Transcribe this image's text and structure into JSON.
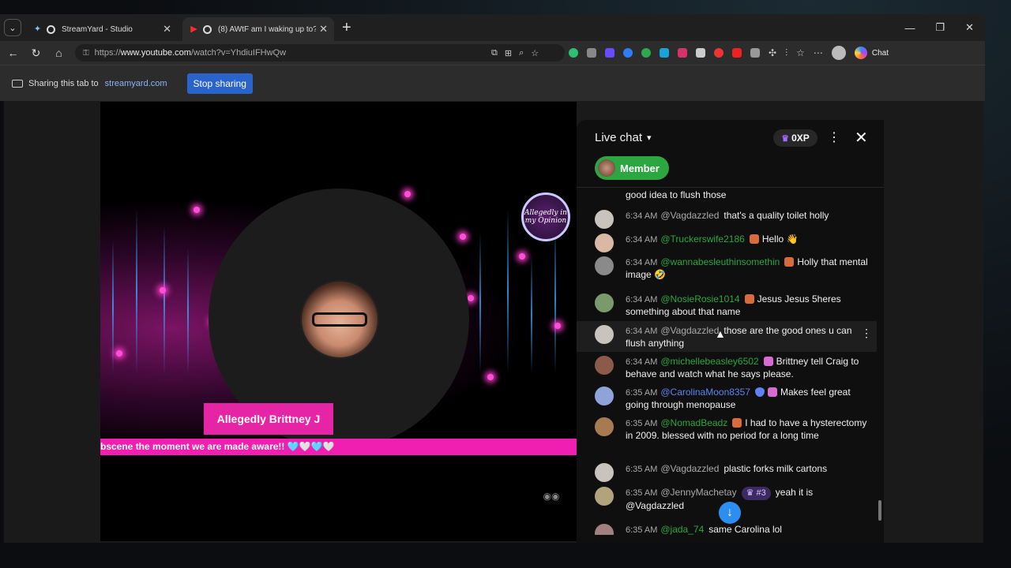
{
  "browser": {
    "tabs": [
      {
        "title": "StreamYard - Studio",
        "icon": "streamyard-icon"
      },
      {
        "title": "(8) AWtF am I waking up to?!",
        "icon": "youtube-icon"
      }
    ],
    "url_prefix": "https://",
    "url_host": "www.youtube.com",
    "url_path": "/watch?v=YhdiuIFHwQw",
    "copilot_label": "Chat"
  },
  "sharebar": {
    "text": "Sharing this tab to",
    "host": "streamyard.com",
    "stop_label": "Stop sharing"
  },
  "video": {
    "logo_text": "Allegedly in my Opinion",
    "name_plate": "Allegedly Brittney J",
    "ticker": "bscene the moment we are made aware!! 🩵🤍🩵🤍"
  },
  "chat": {
    "title": "Live chat",
    "xp": "0XP",
    "member_label": "Member",
    "messages": [
      {
        "time": "",
        "author": "",
        "text": "good idea to flush those"
      },
      {
        "time": "6:34 AM",
        "author": "@Vagdazzled",
        "text": "that's a quality toilet holly"
      },
      {
        "time": "6:34 AM",
        "author": "@Truckerswife2186",
        "text": "Hello 👋"
      },
      {
        "time": "6:34 AM",
        "author": "@wannabesleuthinsomethin",
        "text": "Holly that mental image 🤣"
      },
      {
        "time": "6:34 AM",
        "author": "@NosieRosie1014",
        "text": "Jesus Jesus 5heres something about that name"
      },
      {
        "time": "6:34 AM",
        "author": "@Vagdazzled",
        "text": "those are the good ones u can flush anything"
      },
      {
        "time": "6:34 AM",
        "author": "@michellebeasley6502",
        "text": "Brittney tell Craig to behave and watch what he says please."
      },
      {
        "time": "6:35 AM",
        "author": "@CarolinaMoon8357",
        "text": "Makes feel great going through menopause"
      },
      {
        "time": "6:35 AM",
        "author": "@NomadBeadz",
        "text": "I had to have a hysterectomy in 2009. blessed with no period for a long time"
      },
      {
        "time": "6:35 AM",
        "author": "@Vagdazzled",
        "text": "plastic forks milk cartons"
      },
      {
        "time": "6:35 AM",
        "author": "@JennyMachetay",
        "rank": "#3",
        "text": "yeah it is @Vagdazzled"
      },
      {
        "time": "6:35 AM",
        "author": "@jada_74",
        "text": "same Carolina lol"
      }
    ]
  }
}
